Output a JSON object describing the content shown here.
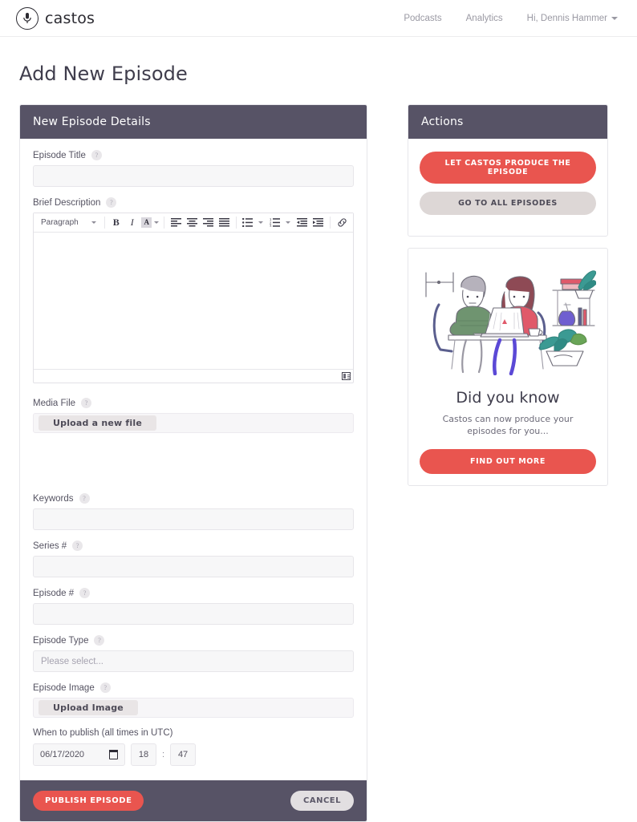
{
  "brand": {
    "name": "castos",
    "icon": "microphone-icon"
  },
  "nav": {
    "podcasts": "Podcasts",
    "analytics": "Analytics",
    "account": "Hi, Dennis Hammer"
  },
  "page": {
    "title": "Add New Episode"
  },
  "colors": {
    "accent_red": "#e9554f",
    "panel_header": "#575366",
    "muted_button": "#ddd7d6",
    "field_bg": "#f7f7f8"
  },
  "main_panel": {
    "header": "New Episode Details",
    "fields": {
      "episode_title": {
        "label": "Episode Title",
        "value": "",
        "help": "?"
      },
      "brief_description": {
        "label": "Brief Description",
        "value": "",
        "help": "?"
      },
      "media_file": {
        "label": "Media File",
        "button": "Upload a new file",
        "help": "?"
      },
      "keywords": {
        "label": "Keywords",
        "value": "",
        "help": "?"
      },
      "series_number": {
        "label": "Series #",
        "value": "",
        "help": "?"
      },
      "episode_number": {
        "label": "Episode #",
        "value": "",
        "help": "?"
      },
      "episode_type": {
        "label": "Episode Type",
        "placeholder": "Please select...",
        "value": "",
        "help": "?"
      },
      "episode_image": {
        "label": "Episode Image",
        "button": "Upload Image",
        "help": "?"
      },
      "publish": {
        "label": "When to publish (all times in UTC)",
        "date": "06/17/2020",
        "hour": "18",
        "separator": ":",
        "minute": "47"
      }
    },
    "editor": {
      "block_format": "Paragraph",
      "buttons": {
        "bold": "B",
        "italic": "I",
        "text_color": "A",
        "align_left": "align-left",
        "align_center": "align-center",
        "align_right": "align-right",
        "align_justify": "align-justify",
        "bullet_list": "bullet-list",
        "numbered_list": "numbered-list",
        "outdent": "outdent",
        "indent": "indent",
        "link": "link"
      },
      "content": ""
    },
    "footer": {
      "publish": "PUBLISH EPISODE",
      "cancel": "CANCEL"
    }
  },
  "sidebar": {
    "actions": {
      "header": "Actions",
      "primary_button": "LET CASTOS PRODUCE THE EPISODE",
      "secondary_button": "GO TO ALL EPISODES"
    },
    "promo": {
      "title": "Did you know",
      "subtitle": "Castos can now produce your episodes for you...",
      "button": "FIND OUT MORE",
      "illustration": "two-people-at-desk-with-laptop-illustration"
    }
  }
}
